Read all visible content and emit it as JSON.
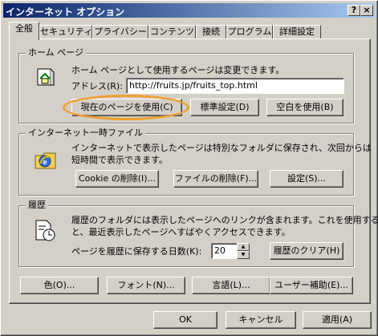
{
  "window": {
    "title": "インターネット オプション",
    "help_label": "?",
    "close_label": "×"
  },
  "tabs": [
    {
      "label": "全般",
      "active": true
    },
    {
      "label": "セキュリティ"
    },
    {
      "label": "プライバシー"
    },
    {
      "label": "コンテンツ"
    },
    {
      "label": "接続"
    },
    {
      "label": "プログラム"
    },
    {
      "label": "詳細設定"
    }
  ],
  "home_page": {
    "title": "ホーム ページ",
    "description": "ホーム ページとして使用するページは変更できます。",
    "address_label": "アドレス(R):",
    "address_value": "http://fruits.jp/fruits_top.html",
    "use_current_label": "現在のページを使用(C)",
    "use_default_label": "標準設定(D)",
    "use_blank_label": "空白を使用(B)"
  },
  "temp_files": {
    "title": "インターネット一時ファイル",
    "description_line1": "インターネットで表示したページは特別なフォルダに保存され、次回からは",
    "description_line2": "短時間で表示できます。",
    "delete_cookies_label": "Cookie の削除(I)...",
    "delete_files_label": "ファイルの削除(F)...",
    "settings_label": "設定(S)..."
  },
  "history": {
    "title": "履歴",
    "description_line1": "履歴のフォルダには表示したページへのリンクが含まれます。これを使用する",
    "description_line2": "と、最近表示したページへすばやくアクセスできます。",
    "days_label": "ページを履歴に保存する日数(K):",
    "days_value": "20",
    "clear_label": "履歴のクリア(H)"
  },
  "bottom_buttons": {
    "colors_label": "色(O)...",
    "fonts_label": "フォント(N)...",
    "languages_label": "言語(L)...",
    "accessibility_label": "ユーザー補助(E)..."
  },
  "dialog_buttons": {
    "ok_label": "OK",
    "cancel_label": "キャンセル",
    "apply_label": "適用(A)"
  },
  "colors": {
    "title_gradient_start": "#0a246a",
    "title_gradient_end": "#a6caf0",
    "highlight_ring": "#f0a030"
  }
}
